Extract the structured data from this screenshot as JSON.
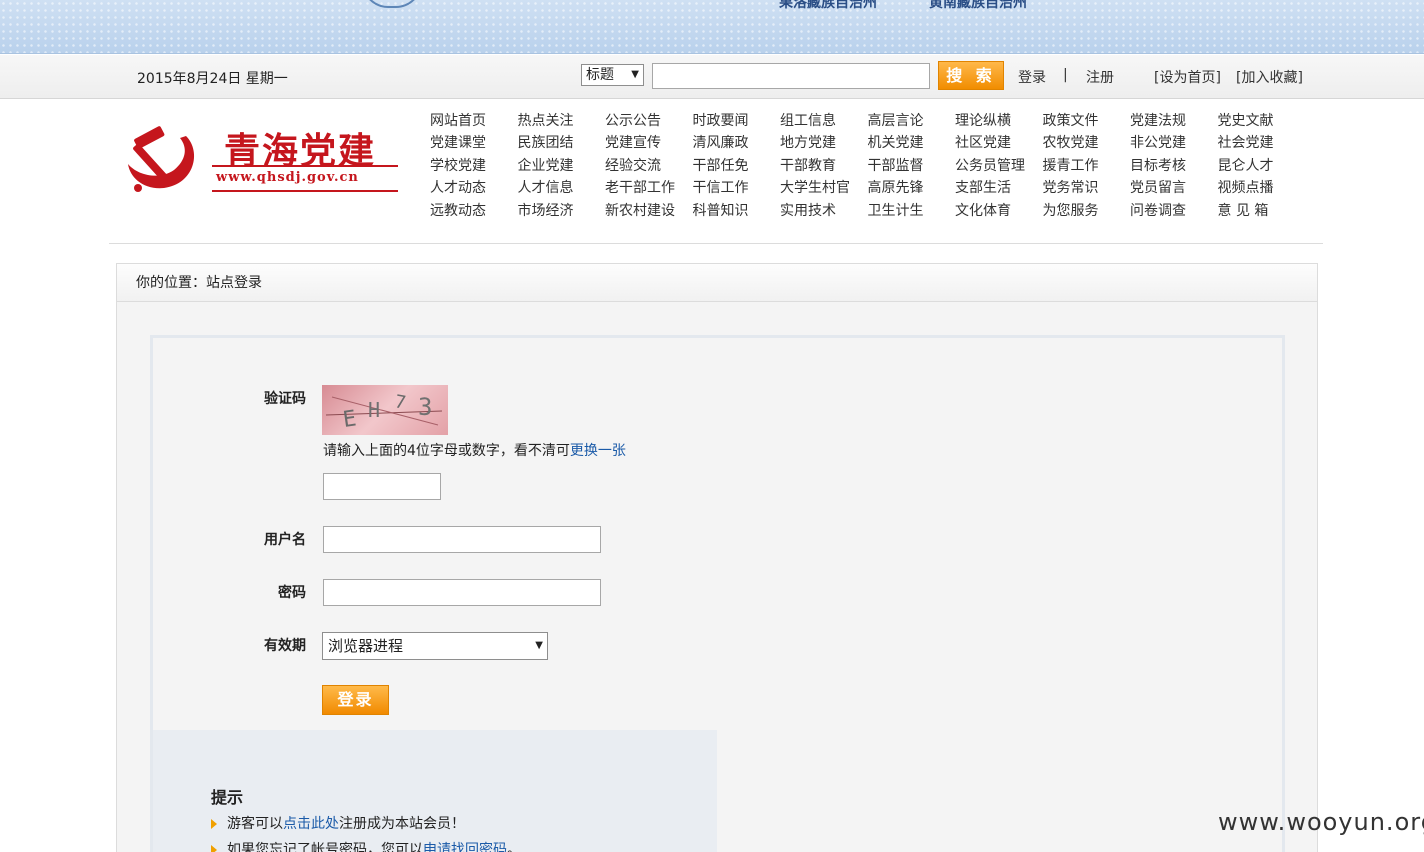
{
  "banner": {
    "region_left": "果洛藏族自治州",
    "region_right": "黄南藏族自治州"
  },
  "toolbar": {
    "date": "2015年8月24日 星期一",
    "search_type": "标题",
    "search_value": "",
    "search_button": "搜 索",
    "login": "登录",
    "separator": "|",
    "register": "注册",
    "set_home": "[设为首页]",
    "favorite": "[加入收藏]"
  },
  "logo": {
    "title": "青海党建",
    "url": "www.qhsdj.gov.cn"
  },
  "nav": [
    [
      "网站首页",
      "热点关注",
      "公示公告",
      "时政要闻",
      "组工信息",
      "高层言论",
      "理论纵横",
      "政策文件",
      "党建法规",
      "党史文献"
    ],
    [
      "党建课堂",
      "民族团结",
      "党建宣传",
      "清风廉政",
      "地方党建",
      "机关党建",
      "社区党建",
      "农牧党建",
      "非公党建",
      "社会党建"
    ],
    [
      "学校党建",
      "企业党建",
      "经验交流",
      "干部任免",
      "干部教育",
      "干部监督",
      "公务员管理",
      "援青工作",
      "目标考核",
      "昆仑人才"
    ],
    [
      "人才动态",
      "人才信息",
      "老干部工作",
      "干信工作",
      "大学生村官",
      "高原先锋",
      "支部生活",
      "党务常识",
      "党员留言",
      "视频点播"
    ],
    [
      "远教动态",
      "市场经济",
      "新农村建设",
      "科普知识",
      "实用技术",
      "卫生计生",
      "文化体育",
      "为您服务",
      "问卷调查",
      "意 见 箱"
    ]
  ],
  "breadcrumb": "你的位置：站点登录",
  "form": {
    "captcha_label": "验证码",
    "captcha_text": "EH73",
    "captcha_hint": "请输入上面的4位字母或数字，看不清可",
    "captcha_refresh": "更换一张",
    "captcha_value": "",
    "username_label": "用户名",
    "username_value": "",
    "password_label": "密码",
    "password_value": "",
    "validity_label": "有效期",
    "validity_value": "浏览器进程",
    "login_button": "登录"
  },
  "tips": {
    "title": "提示",
    "line1_prefix": "游客可以",
    "line1_link": "点击此处",
    "line1_suffix": "注册成为本站会员！",
    "line2_prefix": "如果您忘记了帐号密码，您可以",
    "line2_link": "申请找回密码",
    "line2_suffix": "。"
  },
  "watermark": "www.wooyun.org",
  "colors": {
    "accent_orange": "#f18d00",
    "brand_red": "#c5161d",
    "link_blue": "#1a5aa8"
  }
}
